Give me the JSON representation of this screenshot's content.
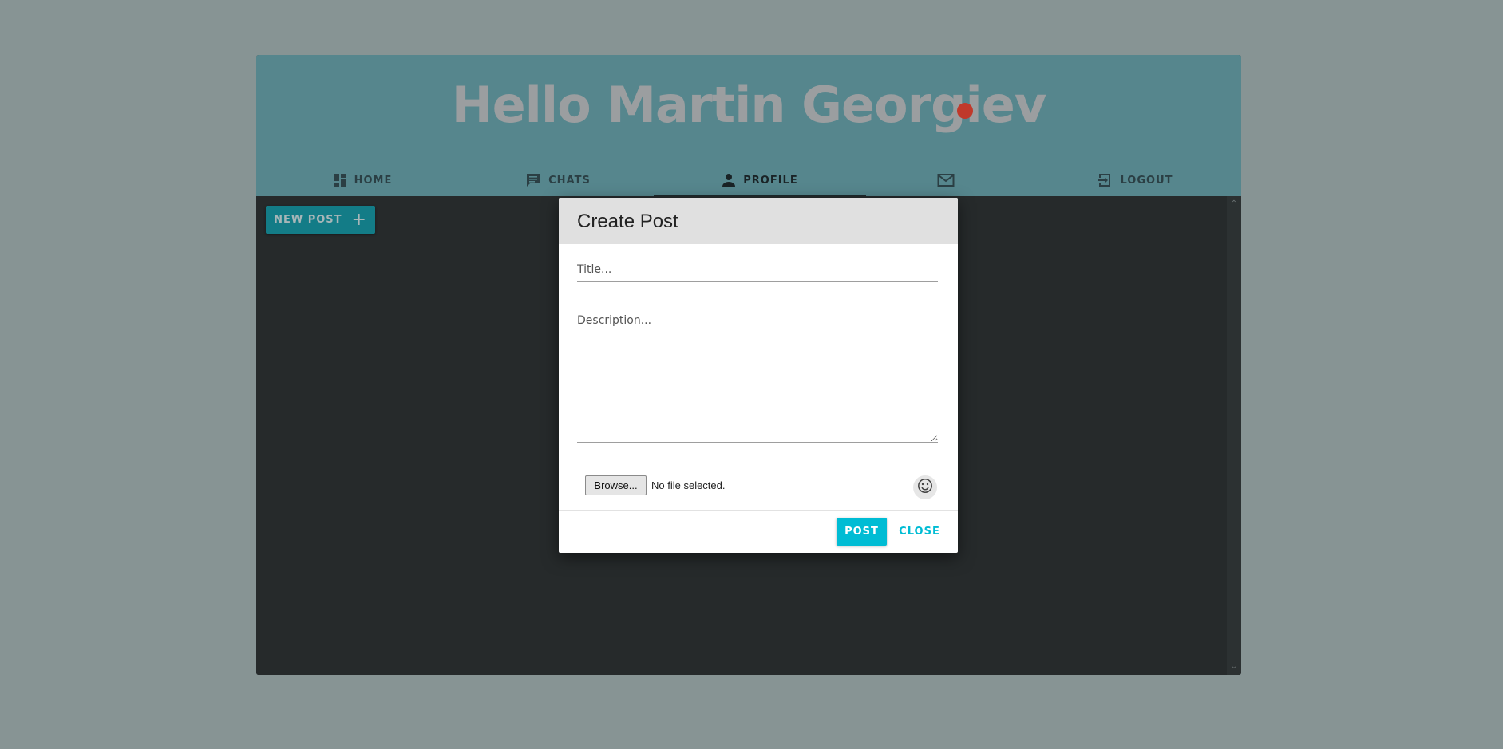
{
  "header": {
    "greeting": "Hello Martin Georgiev"
  },
  "nav": {
    "tabs": [
      {
        "label": "HOME",
        "icon": "dashboard-icon",
        "active": false
      },
      {
        "label": "CHATS",
        "icon": "chat-icon",
        "active": false
      },
      {
        "label": "PROFILE",
        "icon": "person-icon",
        "active": true
      },
      {
        "label": "",
        "icon": "mail-icon",
        "active": false,
        "has_notification": true
      },
      {
        "label": "LOGOUT",
        "icon": "logout-icon",
        "active": false
      }
    ]
  },
  "content": {
    "new_post_label": "NEW POST",
    "new_post_icon": "plus-icon"
  },
  "dialog": {
    "title": "Create Post",
    "title_placeholder": "Title...",
    "description_placeholder": "Description...",
    "browse_label": "Browse...",
    "file_status": "No file selected.",
    "emoji_icon": "smiley-icon",
    "post_label": "POST",
    "close_label": "CLOSE"
  },
  "colors": {
    "page_background": "#879494",
    "header_background": "#56868d",
    "content_background": "#262a2b",
    "accent": "#00bcd4",
    "notification": "#c0392b"
  }
}
